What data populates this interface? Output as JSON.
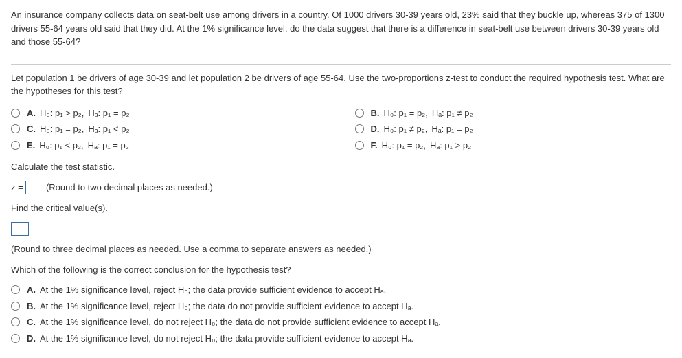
{
  "problem": {
    "setup": "An insurance company collects data on seat-belt use among drivers in a country. Of 1000 drivers 30-39 years old, 23% said that they buckle up, whereas 375 of 1300 drivers 55-64 years old said that they did. At the 1% significance level, do the data suggest that there is a difference in seat-belt use between drivers 30-39 years old and those 55-64?",
    "hypothesis_prompt": "Let population 1 be drivers of age 30-39 and let population 2 be drivers of age 55-64. Use the two-proportions z-test to conduct the required hypothesis test. What are the hypotheses for this test?"
  },
  "hyp_options": {
    "A": {
      "letter": "A.",
      "null": "H₀: p₁ > p₂,",
      "alt": "Hₐ: p₁ = p₂"
    },
    "B": {
      "letter": "B.",
      "null": "H₀: p₁ = p₂,",
      "alt": "Hₐ: p₁ ≠ p₂"
    },
    "C": {
      "letter": "C.",
      "null": "H₀: p₁ = p₂,",
      "alt": "Hₐ: p₁ < p₂"
    },
    "D": {
      "letter": "D.",
      "null": "H₀: p₁ ≠ p₂,",
      "alt": "Hₐ: p₁ = p₂"
    },
    "E": {
      "letter": "E.",
      "null": "H₀: p₁ < p₂,",
      "alt": "Hₐ: p₁ = p₂"
    },
    "F": {
      "letter": "F.",
      "null": "H₀: p₁ = p₂,",
      "alt": "Hₐ: p₁ > p₂"
    }
  },
  "calc": {
    "heading": "Calculate the test statistic.",
    "z_label": "z =",
    "z_hint": "(Round to two decimal places as needed.)"
  },
  "critical": {
    "heading": "Find the critical value(s).",
    "hint": "(Round to three decimal places as needed. Use a comma to separate answers as needed.)"
  },
  "conclusion": {
    "prompt": "Which of the following is the correct conclusion for the hypothesis test?",
    "A": {
      "letter": "A.",
      "text": "At the 1% significance level, reject H₀; the data provide sufficient evidence to accept Hₐ."
    },
    "B": {
      "letter": "B.",
      "text": "At the 1% significance level, reject H₀; the data do not provide sufficient evidence to accept Hₐ."
    },
    "C": {
      "letter": "C.",
      "text": "At the 1% significance level, do not reject H₀; the data do not provide sufficient evidence to accept Hₐ."
    },
    "D": {
      "letter": "D.",
      "text": "At the 1% significance level, do not reject H₀; the data provide sufficient evidence to accept Hₐ."
    }
  }
}
